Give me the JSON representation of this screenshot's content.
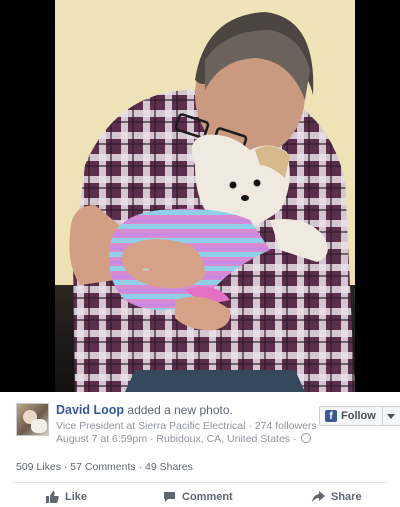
{
  "post": {
    "author": "David Loop",
    "action": "added a new photo.",
    "job_title": "Vice President at Sierra Pacific Electrical",
    "followers": "274 followers",
    "date": "August 7 at 6:59pm",
    "location": "Rubidoux, CA, United States",
    "follow_label": "Follow"
  },
  "stats": {
    "likes": "509 Likes",
    "comments": "57 Comments",
    "shares": "49 Shares"
  },
  "actions": {
    "like": "Like",
    "comment": "Comment",
    "share": "Share"
  },
  "colors": {
    "link": "#365899",
    "facebook_blue": "#3b5998",
    "muted": "#90949c"
  },
  "icons": [
    "facebook-icon",
    "chevron-down-icon",
    "globe-icon",
    "like-icon",
    "comment-icon",
    "share-icon"
  ]
}
